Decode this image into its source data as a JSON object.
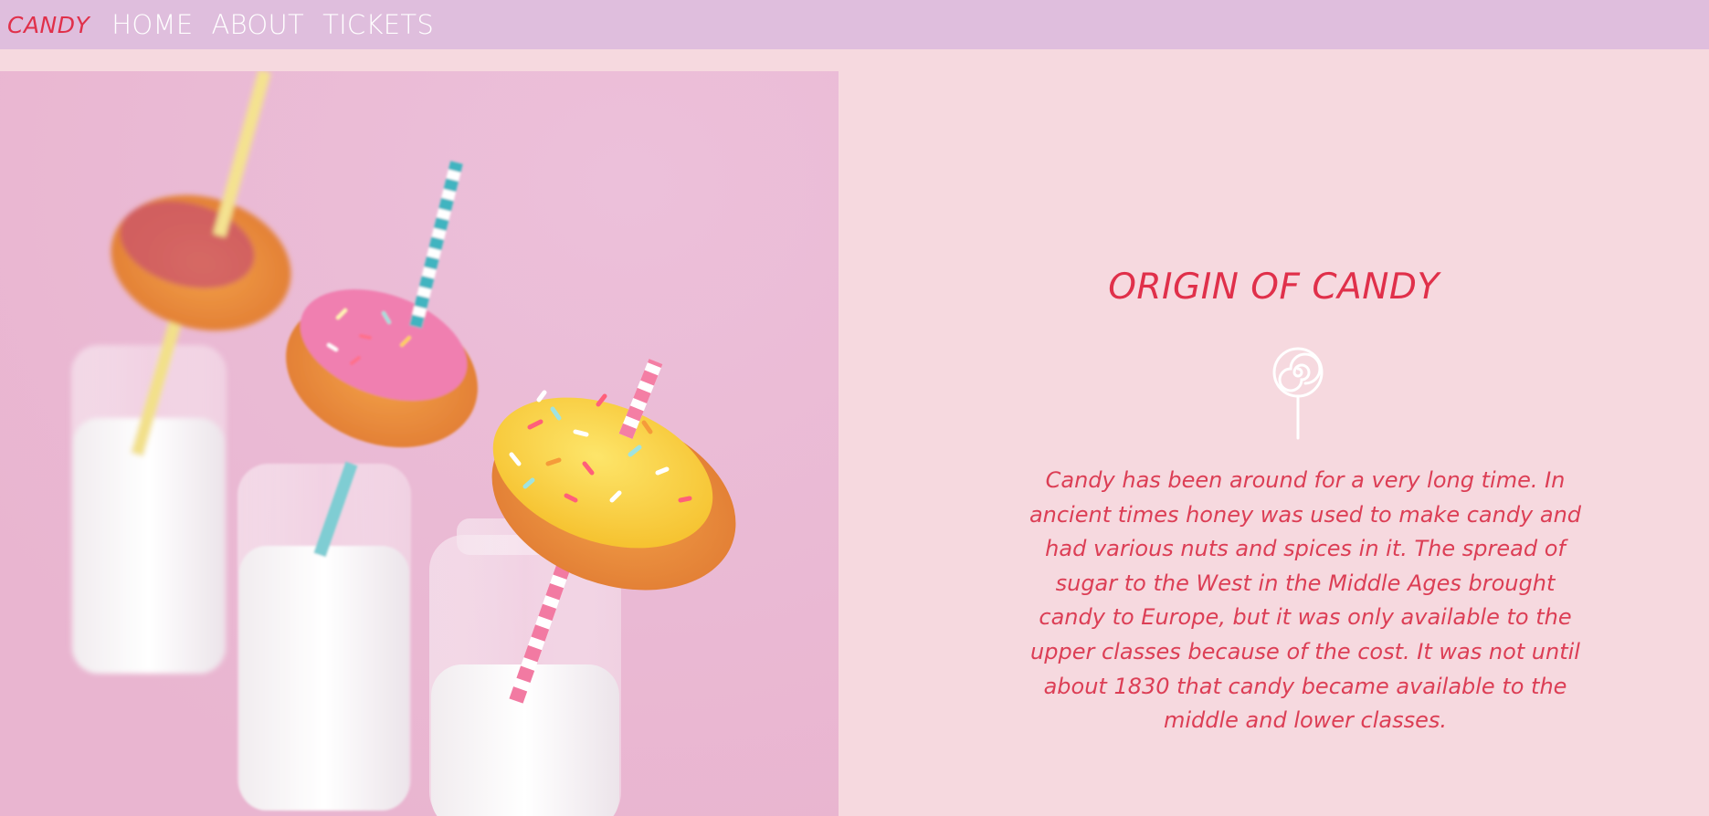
{
  "nav": {
    "brand": "CANDY",
    "links": [
      "HOME",
      "ABOUT",
      "TICKETS"
    ]
  },
  "hero_image": {
    "description_icon": "donuts-on-milk-bottles-photo"
  },
  "section": {
    "title": "ORIGIN OF CANDY",
    "icon": "lollipop-icon",
    "body": "Candy has been around for a very long time. In ancient times honey was used to make candy and had various nuts and spices in it. The spread of sugar to the West in the Middle Ages brought candy to Europe, but it was only available to the upper classes because of the cost. It was not until about 1830 that candy became available to the middle and lower classes."
  },
  "colors": {
    "navbar_bg": "#dfbedd",
    "page_bg": "#f6d9df",
    "accent": "#e0304a",
    "nav_link": "#ffffff"
  }
}
